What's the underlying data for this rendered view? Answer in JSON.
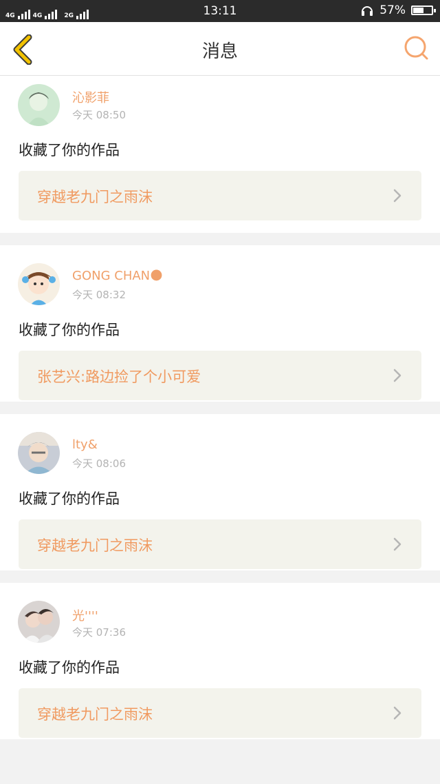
{
  "status_bar": {
    "network_1": "4G",
    "network_2": "4G",
    "network_3": "2G",
    "time": "13:11",
    "battery_percent": "57%",
    "battery_level": 0.57
  },
  "navbar": {
    "title": "消息"
  },
  "notifications": [
    {
      "user": "沁影菲",
      "time": "今天 08:50",
      "action": "收藏了你的作品",
      "work": "穿越老九门之雨沫",
      "avatar_color": "#cfe9d2"
    },
    {
      "user": "GONG CHAN🌑",
      "time": "今天 08:32",
      "action": "收藏了你的作品",
      "work": "张艺兴:路边捡了个小可爱",
      "avatar_color": "#f6efe3"
    },
    {
      "user": "lty&",
      "time": "今天 08:06",
      "action": "收藏了你的作品",
      "work": "穿越老九门之雨沫",
      "avatar_color": "#c8cdd6"
    },
    {
      "user": "光''''",
      "time": "今天 07:36",
      "action": "收藏了你的作品",
      "work": "穿越老九门之雨沫",
      "avatar_color": "#d9d4d2"
    }
  ],
  "colors": {
    "accent": "#f09a60",
    "username": "#f0a06a",
    "back_icon": "#f2c200",
    "timestamp": "#b3b3b3"
  }
}
